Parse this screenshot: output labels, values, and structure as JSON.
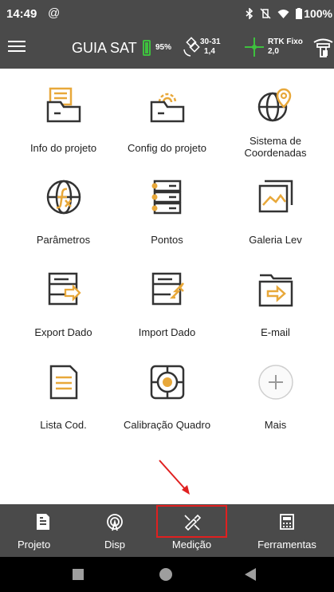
{
  "status_bar": {
    "time": "14:49",
    "at_symbol": "@",
    "battery_percent": "100%"
  },
  "app_bar": {
    "title": "GUIA SATS",
    "battery_percent": "95%",
    "satellites": "30-31",
    "pdop": "1,4",
    "rtk_status": "RTK Fixo",
    "rtk_value": "2,0",
    "accent_green": "#3ec13e"
  },
  "grid": {
    "icon_color": "#e8a83a",
    "items": [
      {
        "label": "Info do projeto",
        "icon": "folder-document-icon"
      },
      {
        "label": "Config do projeto",
        "icon": "folder-gear-icon"
      },
      {
        "label": "Sistema de\nCoordenadas",
        "icon": "globe-location-icon"
      },
      {
        "label": "Parâmetros",
        "icon": "globe-function-icon"
      },
      {
        "label": "Pontos",
        "icon": "server-points-icon"
      },
      {
        "label": "Galeria Lev",
        "icon": "image-gallery-icon"
      },
      {
        "label": "Export Dado",
        "icon": "export-data-icon"
      },
      {
        "label": "Import Dado",
        "icon": "import-data-icon"
      },
      {
        "label": "E-mail",
        "icon": "folder-send-icon"
      },
      {
        "label": "Lista Cod.",
        "icon": "code-list-icon"
      },
      {
        "label": "Calibração Quadro",
        "icon": "target-calibration-icon"
      },
      {
        "label": "Mais",
        "icon": "plus-circle-icon"
      }
    ]
  },
  "bottom_nav": {
    "items": [
      {
        "label": "Projeto",
        "icon": "project-document-icon"
      },
      {
        "label": "Disp",
        "icon": "device-signal-icon"
      },
      {
        "label": "Medição",
        "icon": "measure-pen-icon"
      },
      {
        "label": "Ferramentas",
        "icon": "calculator-icon"
      }
    ],
    "highlight_color": "#e02020"
  }
}
